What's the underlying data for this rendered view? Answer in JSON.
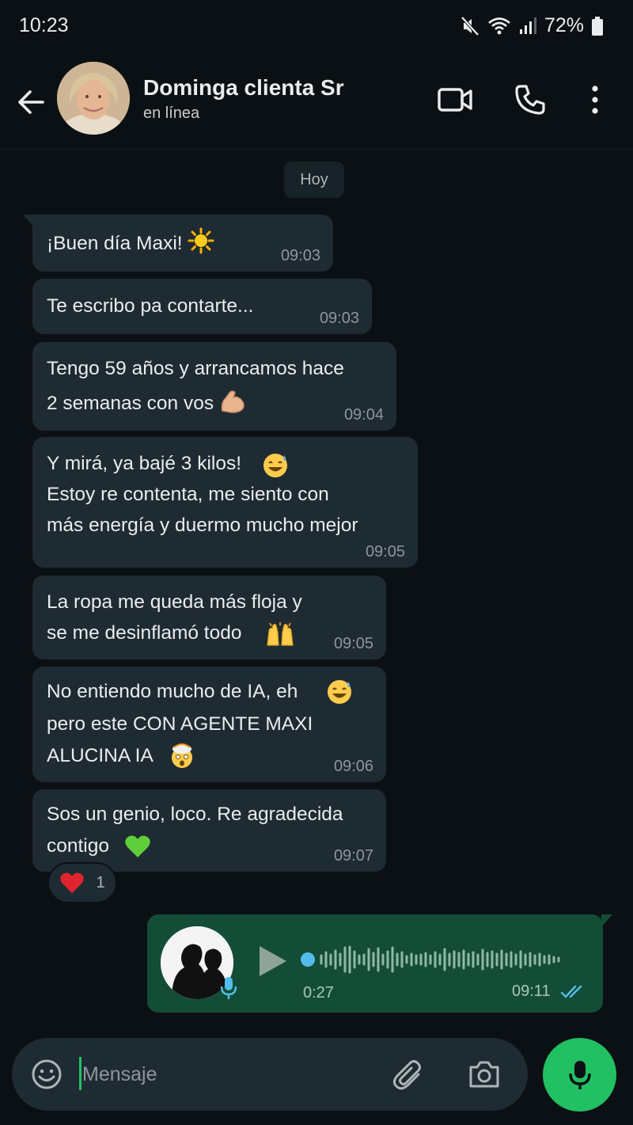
{
  "status_bar": {
    "time": "10:23",
    "battery": "72%"
  },
  "header": {
    "name": "Dominga clienta Sr",
    "status": "en línea"
  },
  "date_chip": "Hoy",
  "messages": [
    {
      "text": "¡Buen día Maxi!",
      "time": "09:03",
      "emoji": "sun-emoji"
    },
    {
      "text": "Te escribo pa contarte...",
      "time": "09:03"
    },
    {
      "text": "Tengo 59 años y arrancamos hace\n2 semanas con vos",
      "time": "09:04",
      "emoji": "flexed-biceps-emoji"
    },
    {
      "text": "Y mirá, ya bajé 3 kilos!\nEstoy re contenta, me siento con\nmás energía y duermo mucho mejor",
      "time": "09:05",
      "emoji": "grinning-sweat-emoji"
    },
    {
      "text": "La ropa me queda más floja y\nse me desinflamó todo",
      "time": "09:05",
      "emoji": "raising-hands-emoji"
    },
    {
      "text": "No entiendo mucho de IA, eh\npero este CON AGENTE MAXI\nALUCINA IA",
      "time": "09:06",
      "emoji": "grinning-sweat-emoji"
    },
    {
      "text": "Sos un genio, loco. Re agradecida\ncontigo",
      "time": "09:07",
      "emoji": "green-heart-emoji"
    }
  ],
  "reaction": {
    "emoji": "red-heart-emoji",
    "count": "1"
  },
  "audio_message": {
    "duration": "0:27",
    "time": "09:11",
    "status": "read"
  },
  "input": {
    "placeholder": "Mensaje"
  },
  "colors": {
    "background": "#0b1014",
    "incoming_bubble": "#1f2b32",
    "outgoing_bubble": "#144d37",
    "accent": "#21c063",
    "read_ticks": "#53bdeb"
  }
}
